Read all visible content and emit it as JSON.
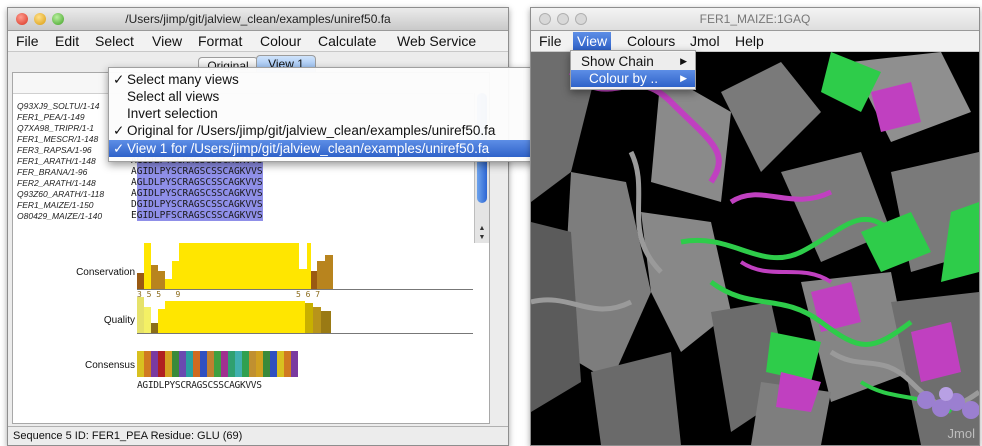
{
  "jalview": {
    "title": "/Users/jimp/git/jalview_clean/examples/uniref50.fa",
    "menu": [
      "File",
      "Edit",
      "Select",
      "View",
      "Format",
      "Colour",
      "Calculate",
      "Web Service"
    ],
    "tabs": [
      "Original",
      "View 1"
    ],
    "sequence_names": [
      "Q93XJ9_SOLTU/1-14",
      "FER1_PEA/1-149",
      "Q7XA98_TRIPR/1-1",
      "FER1_MESCR/1-148",
      "FER3_RAPSA/1-96",
      "FER1_ARATH/1-148",
      "FER_BRANA/1-96",
      "FER2_ARATH/1-148",
      "Q93Z60_ARATH/1-118",
      "FER1_MAIZE/1-150",
      "O80429_MAIZE/1-140"
    ],
    "visible_rows": [
      {
        "lead": "A",
        "residues": "GIDLPYSCRAGSCSSCAGKVVS"
      },
      {
        "lead": "A",
        "residues": "GIDLPYSCRAGSCSSCAGKVVS"
      },
      {
        "lead": "A",
        "residues": "GLDLPYSCRAGSCSSCAGKVVS"
      },
      {
        "lead": "A",
        "residues": "GIDLPYSCRAGSCSSCAGKVVS"
      },
      {
        "lead": "D",
        "residues": "GIDLPYSCRAGSCSSCAGKVVS"
      },
      {
        "lead": "E",
        "residues": "GIDLPFSCRAGSCSSCAGKVVS"
      }
    ],
    "annotations": {
      "conservation_label": "Conservation",
      "conservation_scores": "3 5 5   9                        5 6 7",
      "quality_label": "Quality",
      "consensus_label": "Consensus",
      "consensus_sequence": "AGIDLPYSCRAGSCSSCAGKVVS"
    },
    "status": "Sequence 5 ID: FER1_PEA   Residue: GLU (69)",
    "select_popup": [
      {
        "label": "Select many views",
        "checked": true
      },
      {
        "label": "Select all views",
        "checked": false
      },
      {
        "label": "Invert selection",
        "checked": false
      },
      {
        "label": "Original for /Users/jimp/git/jalview_clean/examples/uniref50.fa",
        "checked": true
      },
      {
        "label": "View 1 for /Users/jimp/git/jalview_clean/examples/uniref50.fa",
        "checked": true,
        "highlighted": true
      }
    ],
    "check_glyph": "✓"
  },
  "jmol_window": {
    "title": "FER1_MAIZE:1GAQ",
    "menu": [
      "File",
      "View",
      "Colours",
      "Jmol",
      "Help"
    ],
    "active_menu": "View",
    "view_menu": [
      {
        "label": "Show Chain",
        "submenu": true
      },
      {
        "label": "Colour by ..",
        "submenu": true,
        "highlighted": true
      }
    ],
    "submenu_arrow": "▶",
    "watermark": "Jmol"
  },
  "colors": {
    "selection_blue": "#8f8fe8",
    "highlight_blue": "#2f62c9",
    "conservation_yellow": "#ffe600",
    "conservation_brown": "#9a5a12",
    "ribbon_gray": "#8c8c8c",
    "ribbon_green": "#2ecc4a",
    "ribbon_magenta": "#c040c0",
    "atom_purple": "#9b7fd0"
  }
}
